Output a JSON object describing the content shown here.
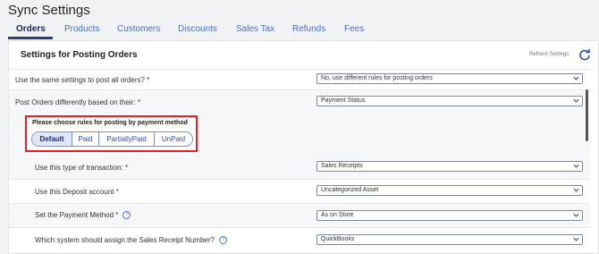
{
  "page": {
    "title": "Sync Settings"
  },
  "tabs": [
    "Orders",
    "Products",
    "Customers",
    "Discounts",
    "Sales Tax",
    "Refunds",
    "Fees"
  ],
  "section": {
    "title": "Settings for Posting Orders",
    "refresh_label": "Refresh Settings"
  },
  "settings": [
    {
      "label": "Use the same settings to post all orders?",
      "required": " *",
      "value": "No, use different rules for posting orders"
    },
    {
      "label": "Post Orders differently based on their:",
      "required": " *",
      "value": "Payment Status"
    },
    {
      "label": "Use this type of transaction:",
      "required": " *",
      "value": "Sales Receipts"
    },
    {
      "label": "Use this Deposit account",
      "required": " *",
      "value": "Uncategorized Asset"
    },
    {
      "label": "Set the Payment Method",
      "required": " *",
      "value": "As on Store"
    },
    {
      "label": "Which system should assign the Sales Receipt Number?",
      "required": "",
      "value": "QuickBooks"
    }
  ],
  "rules": {
    "title": "Please choose rules for posting by payment method",
    "options": [
      "Default",
      "Paid",
      "PartiallyPaid",
      "UnPaid"
    ],
    "selected": "Default"
  },
  "icons": {
    "help": "question-circle-icon",
    "refresh": "refresh-icon",
    "dropdown": "chevron-down-icon"
  },
  "colors": {
    "accent": "#2e4eb2",
    "highlight_border": "#e0202a",
    "active_tab": "#1a2a55"
  }
}
